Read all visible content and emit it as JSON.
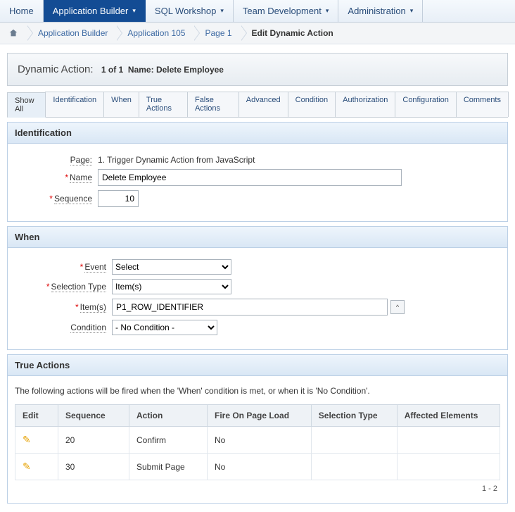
{
  "topnav": {
    "items": [
      {
        "label": "Home",
        "caret": false,
        "active": false
      },
      {
        "label": "Application Builder",
        "caret": true,
        "active": true
      },
      {
        "label": "SQL Workshop",
        "caret": true,
        "active": false
      },
      {
        "label": "Team Development",
        "caret": true,
        "active": false
      },
      {
        "label": "Administration",
        "caret": true,
        "active": false
      }
    ]
  },
  "breadcrumbs": [
    {
      "label": "",
      "icon": "home-icon"
    },
    {
      "label": "Application Builder"
    },
    {
      "label": "Application 105"
    },
    {
      "label": "Page 1"
    },
    {
      "label": "Edit Dynamic Action",
      "current": true
    }
  ],
  "header": {
    "title": "Dynamic Action:",
    "position": "1 of 1",
    "name_prefix": "Name:",
    "name": "Delete Employee"
  },
  "tabs": [
    "Show All",
    "Identification",
    "When",
    "True Actions",
    "False Actions",
    "Advanced",
    "Condition",
    "Authorization",
    "Configuration",
    "Comments"
  ],
  "identification": {
    "heading": "Identification",
    "page_label": "Page:",
    "page_value": "1. Trigger Dynamic Action from JavaScript",
    "name_label": "Name",
    "name_value": "Delete Employee",
    "sequence_label": "Sequence",
    "sequence_value": "10"
  },
  "when": {
    "heading": "When",
    "event_label": "Event",
    "event_value": "Select",
    "seltype_label": "Selection Type",
    "seltype_value": "Item(s)",
    "items_label": "Item(s)",
    "items_value": "P1_ROW_IDENTIFIER",
    "condition_label": "Condition",
    "condition_value": "- No Condition -"
  },
  "true_actions": {
    "heading": "True Actions",
    "note": "The following actions will be fired when the 'When' condition is met, or when it is 'No Condition'.",
    "columns": [
      "Edit",
      "Sequence",
      "Action",
      "Fire On Page Load",
      "Selection Type",
      "Affected Elements"
    ],
    "rows": [
      {
        "sequence": "20",
        "action": "Confirm",
        "fire": "No",
        "seltype": "",
        "affected": ""
      },
      {
        "sequence": "30",
        "action": "Submit Page",
        "fire": "No",
        "seltype": "",
        "affected": ""
      }
    ],
    "pager": "1 - 2"
  }
}
